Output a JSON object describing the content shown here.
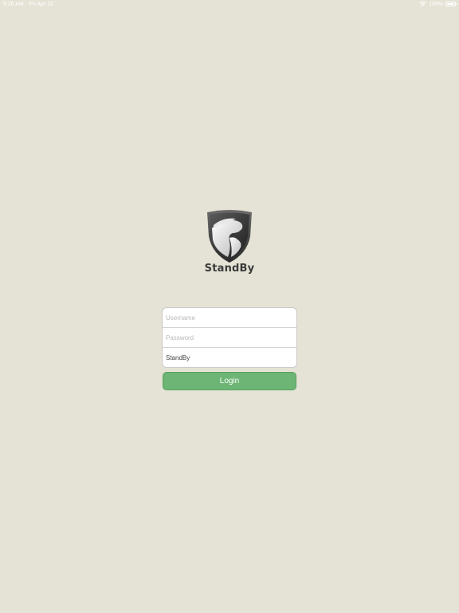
{
  "status_bar": {
    "time": "9:26 AM",
    "date": "Fri Apr 12",
    "battery": "100%",
    "wifi_icon": "wifi-icon",
    "battery_icon": "battery-icon",
    "battery_level": 1.0
  },
  "brand": {
    "logo_icon": "shield-logo-icon",
    "name": "StandBy"
  },
  "login_form": {
    "username": {
      "placeholder": "Username",
      "value": ""
    },
    "password": {
      "placeholder": "Password",
      "value": ""
    },
    "company": {
      "placeholder": "",
      "value": "StandBy"
    },
    "submit_label": "Login"
  },
  "colors": {
    "background": "#e5e3d5",
    "button": "#6cb574",
    "button_text": "#ffffff",
    "brand_text": "#3a3a3a"
  }
}
